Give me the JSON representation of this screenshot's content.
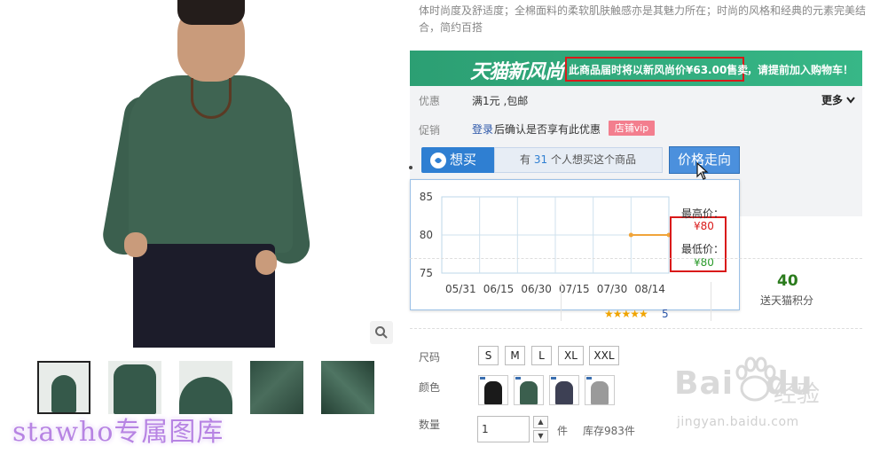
{
  "product": {
    "description": "体时尚度及舒适度；全棉面料的柔软肌肤触感亦是其魅力所在；时尚的风格和经典的元素完美结合，简约百搭"
  },
  "promo": {
    "logo": "天猫新风尚",
    "text_highlight": "此商品届时将以新风尚价¥63.00售卖",
    "text_rest": "，请提前加入购物车！"
  },
  "discount": {
    "label": "优惠",
    "value": "满1元 ,包邮",
    "more_label": "更多"
  },
  "promotion": {
    "label": "促销",
    "login_link": "登录",
    "login_text": "后确认是否享有此优惠",
    "vip_tag": "店铺vip"
  },
  "want": {
    "button_label": "想买",
    "count_prefix": "有",
    "count": "31",
    "count_suffix": "个人想买这个商品"
  },
  "trend_button": "价格走向",
  "price_summary": {
    "high_label": "最高价：",
    "high_value": "¥80",
    "low_label": "最低价：",
    "low_value": "¥80"
  },
  "chart_data": {
    "type": "line",
    "title": "",
    "xlabel": "",
    "ylabel": "",
    "x_ticks": [
      "05/31",
      "06/15",
      "06/30",
      "07/15",
      "07/30",
      "08/14"
    ],
    "y_ticks": [
      "85",
      "80",
      "75"
    ],
    "ylim": [
      75,
      85
    ],
    "grid": true,
    "series": [
      {
        "x": [
          "07/30",
          "08/14"
        ],
        "values": [
          80,
          80
        ]
      }
    ],
    "line_color": "#f0a43a"
  },
  "rating": {
    "stars": "★★★★★",
    "score": "5"
  },
  "points": {
    "value": "40",
    "label": "送天猫积分"
  },
  "sizes": {
    "label": "尺码",
    "options": [
      "S",
      "M",
      "L",
      "XL",
      "XXL"
    ]
  },
  "colors": {
    "label": "颜色",
    "swatches": [
      "#1a1a1a",
      "#3b5f4e",
      "#3d4054",
      "#9a9a9a"
    ]
  },
  "quantity": {
    "label": "数量",
    "value": "1",
    "unit": "件",
    "stock": "库存983件"
  },
  "watermarks": {
    "left": "stawho专属图库",
    "baidu_brand": "Bai",
    "baidu_brand_tail": "du",
    "baidu_cn": "经验",
    "baidu_url": "jingyan.baidu.com"
  },
  "icons": {
    "zoom": "magnifier-icon",
    "want": "want-icon",
    "cursor": "cursor-icon",
    "more": "chevron-down-icon"
  }
}
